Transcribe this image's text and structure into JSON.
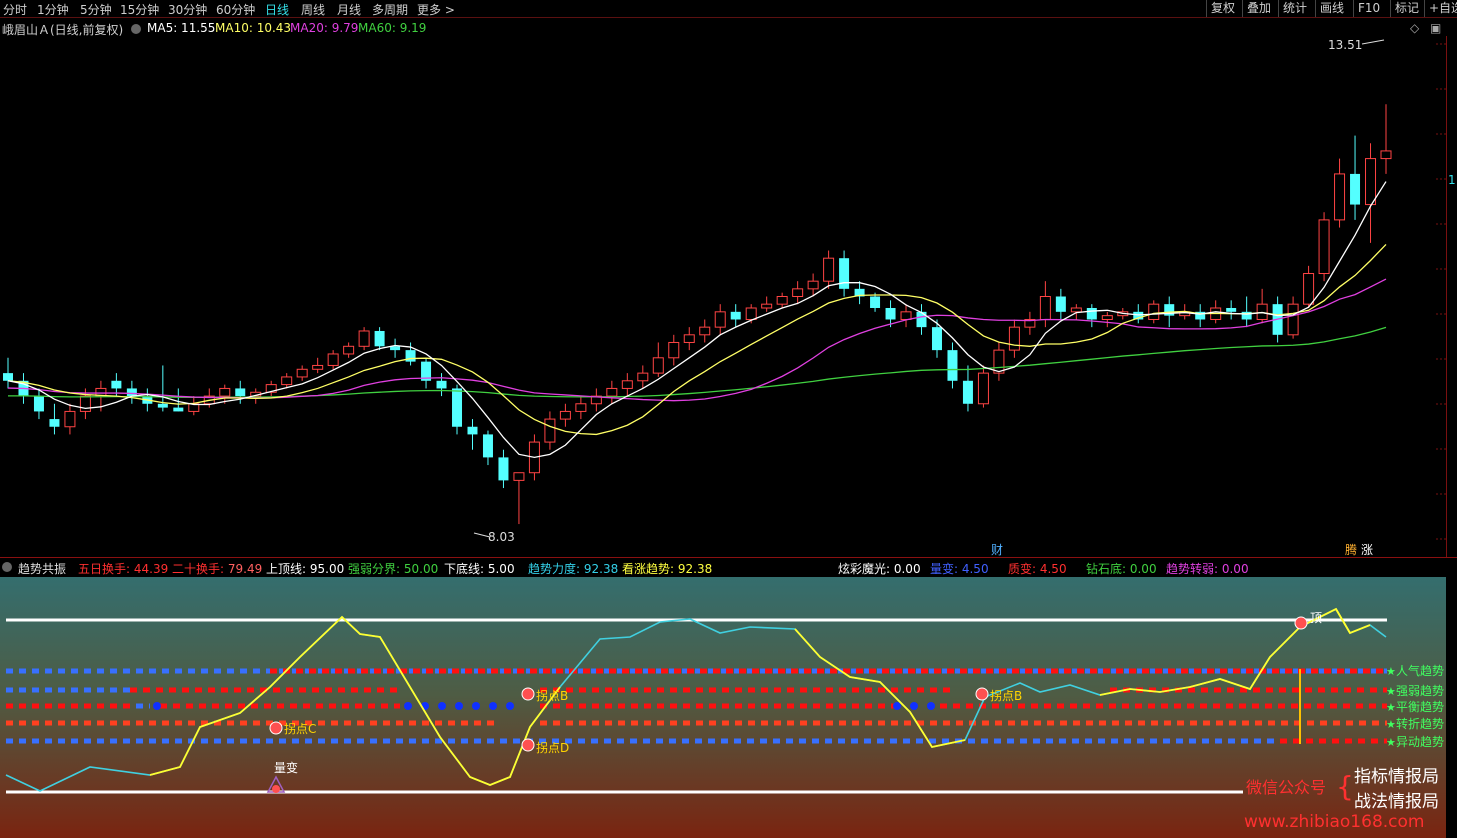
{
  "toolbar": {
    "left_items": [
      "分时",
      "1分钟",
      "5分钟",
      "15分钟",
      "30分钟",
      "60分钟",
      "日线",
      "周线",
      "月线",
      "多周期",
      "更多 >"
    ],
    "active": "日线",
    "right_items": [
      "复权",
      "叠加",
      "统计",
      "画线",
      "F10",
      "标记",
      "+自选"
    ]
  },
  "main_legend": {
    "title": "峨眉山Ａ(日线,前复权)",
    "ma": [
      {
        "label": "MA5: 11.55",
        "color": "#ffffff"
      },
      {
        "label": "MA10: 10.43",
        "color": "#ffff66"
      },
      {
        "label": "MA20: 9.79",
        "color": "#e040e0"
      },
      {
        "label": "MA60: 9.19",
        "color": "#40d040"
      }
    ]
  },
  "annotations": {
    "high": "13.51",
    "low": "8.03",
    "marker_cai": "财",
    "marker_teng": "腾",
    "marker_zhang": "涨",
    "right_edge_value": "1"
  },
  "indicator_legend": {
    "name": "趋势共振",
    "items": [
      {
        "label": "五日换手",
        "value": "44.39",
        "lc": "#ff3030",
        "vc": "#ff3030"
      },
      {
        "label": "二十换手",
        "value": "79.49",
        "lc": "#ff3030",
        "vc": "#ff6060"
      },
      {
        "label": "上顶线",
        "value": "95.00",
        "lc": "#ffffff",
        "vc": "#ffffff"
      },
      {
        "label": "强弱分界",
        "value": "50.00",
        "lc": "#40d040",
        "vc": "#40d040"
      },
      {
        "label": "下底线",
        "value": "5.00",
        "lc": "#ffffff",
        "vc": "#ffffff"
      },
      {
        "label": "趋势力度",
        "value": "92.38",
        "lc": "#34d0e8",
        "vc": "#34d0e8"
      },
      {
        "label": "看涨趋势",
        "value": "92.38",
        "lc": "#ffff40",
        "vc": "#ffff40"
      },
      {
        "label": "炫彩魔光",
        "value": "0.00",
        "lc": "#ffffff",
        "vc": "#ffffff"
      },
      {
        "label": "量变",
        "value": "4.50",
        "lc": "#4060ff",
        "vc": "#4060ff"
      },
      {
        "label": "质变",
        "value": "4.50",
        "lc": "#ff3030",
        "vc": "#ff3030"
      },
      {
        "label": "钻石底",
        "value": "0.00",
        "lc": "#40d040",
        "vc": "#40d040"
      },
      {
        "label": "趋势转弱",
        "value": "0.00",
        "lc": "#e040e0",
        "vc": "#e040e0"
      }
    ]
  },
  "indicator_labels": {
    "point_c": "拐点C",
    "point_b1": "拐点B",
    "point_d": "拐点D",
    "point_b2": "拐点B",
    "liangbian": "量变",
    "ding": "顶",
    "trend_labels": [
      "人气趋势",
      "强弱趋势",
      "平衡趋势",
      "转折趋势",
      "异动趋势"
    ]
  },
  "watermark": {
    "line1": "指标情报局",
    "line2": "战法情报局",
    "wechat": "微信公众号",
    "url": "www.zhibiao168.com"
  },
  "colors": {
    "up": "#ff4444",
    "down": "#54ffff",
    "ma5": "#ffffff",
    "ma10": "#ffff66",
    "ma20": "#e040e0",
    "ma60": "#40d040"
  },
  "chart_data": {
    "type": "candlestick",
    "ylim": [
      7.6,
      14.4
    ],
    "candles": [
      [
        10.0,
        10.2,
        9.8,
        9.9
      ],
      [
        9.9,
        10.0,
        9.6,
        9.7
      ],
      [
        9.7,
        9.8,
        9.4,
        9.5
      ],
      [
        9.4,
        9.6,
        9.2,
        9.3
      ],
      [
        9.3,
        9.6,
        9.2,
        9.5
      ],
      [
        9.5,
        9.8,
        9.4,
        9.7
      ],
      [
        9.7,
        9.9,
        9.5,
        9.8
      ],
      [
        9.9,
        10.0,
        9.7,
        9.8
      ],
      [
        9.8,
        9.9,
        9.6,
        9.7
      ],
      [
        9.7,
        9.8,
        9.5,
        9.6
      ],
      [
        9.6,
        10.1,
        9.5,
        9.55
      ],
      [
        9.55,
        9.8,
        9.5,
        9.5
      ],
      [
        9.5,
        9.7,
        9.45,
        9.6
      ],
      [
        9.6,
        9.8,
        9.55,
        9.7
      ],
      [
        9.7,
        9.85,
        9.6,
        9.8
      ],
      [
        9.8,
        9.9,
        9.6,
        9.7
      ],
      [
        9.7,
        9.8,
        9.6,
        9.75
      ],
      [
        9.75,
        9.9,
        9.7,
        9.85
      ],
      [
        9.85,
        10.0,
        9.8,
        9.95
      ],
      [
        9.95,
        10.1,
        9.9,
        10.05
      ],
      [
        10.05,
        10.2,
        10.0,
        10.1
      ],
      [
        10.1,
        10.3,
        10.05,
        10.25
      ],
      [
        10.25,
        10.4,
        10.2,
        10.35
      ],
      [
        10.35,
        10.6,
        10.3,
        10.55
      ],
      [
        10.55,
        10.6,
        10.3,
        10.35
      ],
      [
        10.35,
        10.45,
        10.2,
        10.3
      ],
      [
        10.3,
        10.4,
        10.1,
        10.15
      ],
      [
        10.15,
        10.2,
        9.8,
        9.9
      ],
      [
        9.9,
        10.0,
        9.7,
        9.8
      ],
      [
        9.8,
        9.85,
        9.2,
        9.3
      ],
      [
        9.3,
        9.4,
        9.0,
        9.2
      ],
      [
        9.2,
        9.25,
        8.8,
        8.9
      ],
      [
        8.9,
        9.0,
        8.5,
        8.6
      ],
      [
        8.6,
        8.7,
        8.03,
        8.7
      ],
      [
        8.7,
        9.2,
        8.6,
        9.1
      ],
      [
        9.1,
        9.5,
        9.0,
        9.4
      ],
      [
        9.4,
        9.6,
        9.3,
        9.5
      ],
      [
        9.5,
        9.7,
        9.4,
        9.6
      ],
      [
        9.6,
        9.8,
        9.5,
        9.7
      ],
      [
        9.7,
        9.9,
        9.6,
        9.8
      ],
      [
        9.8,
        10.0,
        9.7,
        9.9
      ],
      [
        9.9,
        10.1,
        9.8,
        10.0
      ],
      [
        10.0,
        10.4,
        9.95,
        10.2
      ],
      [
        10.2,
        10.5,
        10.1,
        10.4
      ],
      [
        10.4,
        10.6,
        10.3,
        10.5
      ],
      [
        10.5,
        10.7,
        10.4,
        10.6
      ],
      [
        10.6,
        10.9,
        10.5,
        10.8
      ],
      [
        10.8,
        10.9,
        10.6,
        10.7
      ],
      [
        10.7,
        10.9,
        10.65,
        10.85
      ],
      [
        10.85,
        11.0,
        10.8,
        10.9
      ],
      [
        10.9,
        11.05,
        10.85,
        11.0
      ],
      [
        11.0,
        11.2,
        10.9,
        11.1
      ],
      [
        11.1,
        11.3,
        11.0,
        11.2
      ],
      [
        11.2,
        11.6,
        11.1,
        11.5
      ],
      [
        11.5,
        11.6,
        11.0,
        11.1
      ],
      [
        11.1,
        11.2,
        10.9,
        11.0
      ],
      [
        11.0,
        11.05,
        10.8,
        10.85
      ],
      [
        10.85,
        10.95,
        10.6,
        10.7
      ],
      [
        10.7,
        10.9,
        10.6,
        10.8
      ],
      [
        10.8,
        10.9,
        10.5,
        10.6
      ],
      [
        10.6,
        10.7,
        10.2,
        10.3
      ],
      [
        10.3,
        10.4,
        9.8,
        9.9
      ],
      [
        9.9,
        10.1,
        9.5,
        9.6
      ],
      [
        9.6,
        10.1,
        9.55,
        10.0
      ],
      [
        10.0,
        10.4,
        9.9,
        10.3
      ],
      [
        10.3,
        10.7,
        10.2,
        10.6
      ],
      [
        10.6,
        10.8,
        10.5,
        10.7
      ],
      [
        10.7,
        11.2,
        10.6,
        11.0
      ],
      [
        11.0,
        11.1,
        10.7,
        10.8
      ],
      [
        10.8,
        10.9,
        10.7,
        10.85
      ],
      [
        10.85,
        10.9,
        10.6,
        10.7
      ],
      [
        10.7,
        10.8,
        10.6,
        10.75
      ],
      [
        10.75,
        10.85,
        10.7,
        10.8
      ],
      [
        10.8,
        10.9,
        10.65,
        10.7
      ],
      [
        10.7,
        10.95,
        10.65,
        10.9
      ],
      [
        10.9,
        11.0,
        10.6,
        10.75
      ],
      [
        10.75,
        10.9,
        10.7,
        10.8
      ],
      [
        10.8,
        10.9,
        10.6,
        10.7
      ],
      [
        10.7,
        10.95,
        10.65,
        10.85
      ],
      [
        10.85,
        10.95,
        10.7,
        10.8
      ],
      [
        10.8,
        11.0,
        10.6,
        10.7
      ],
      [
        10.7,
        11.1,
        10.65,
        10.9
      ],
      [
        10.9,
        11.0,
        10.4,
        10.5
      ],
      [
        10.5,
        11.0,
        10.45,
        10.9
      ],
      [
        10.9,
        11.4,
        10.85,
        11.3
      ],
      [
        11.3,
        12.1,
        11.2,
        12.0
      ],
      [
        12.0,
        12.8,
        11.9,
        12.6
      ],
      [
        12.6,
        13.1,
        12.0,
        12.2
      ],
      [
        12.2,
        13.0,
        11.7,
        12.8
      ],
      [
        12.8,
        13.51,
        12.6,
        12.9
      ]
    ]
  }
}
